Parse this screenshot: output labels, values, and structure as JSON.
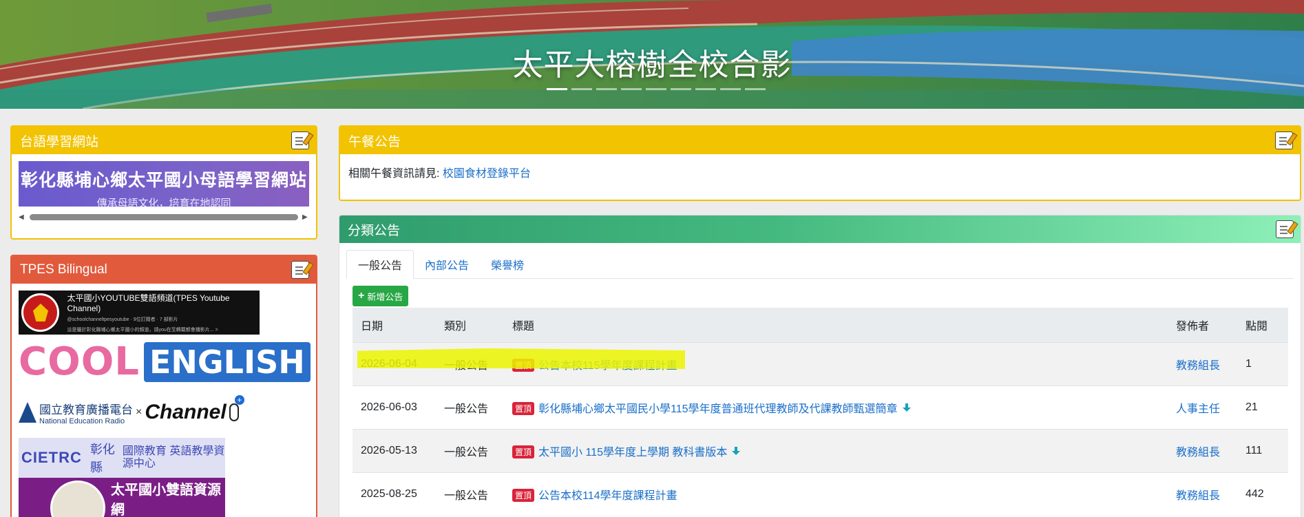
{
  "banner": {
    "title": "太平大榕樹全校合影",
    "slide_count": 9,
    "active_slide": 1
  },
  "taiyu": {
    "header": "台語學習網站",
    "banner_title": "彰化縣埔心鄉太平國小母語學習網站",
    "banner_subtitle": "傳承母語文化，培育在地認同"
  },
  "bilingual": {
    "header": "TPES Bilingual",
    "youtube_title": "太平國小YOUTUBE雙語頻道(TPES Youtube Channel)",
    "youtube_handle": "@schoolchanneltpesyoutube · 9位訂閱者 · 7 部影片",
    "youtube_desc": "這是屬於彰化縣埔心鄉太平國小的頻道，請you在至轉載都會播影片... >",
    "cool": "COOL",
    "english": "ENGLISH",
    "ner_cn": "國立教育廣播電台",
    "ner_en": "National Education Radio",
    "ner_x": "×",
    "channel": "Channel",
    "cietrc_logo": "CIETRC",
    "cietrc_county": "彰化縣",
    "cietrc_name": "國際教育 英語教學資源中心",
    "bilingual_net": "太平國小雙語資源網"
  },
  "lunch": {
    "header": "午餐公告",
    "text": "相關午餐資訊請見: ",
    "link": "校園食材登錄平台"
  },
  "news": {
    "header": "分類公告",
    "tabs": [
      "一般公告",
      "內部公告",
      "榮譽榜"
    ],
    "active_tab": 0,
    "add_button": "新增公告",
    "columns": [
      "日期",
      "類別",
      "標題",
      "發佈者",
      "點閱"
    ],
    "pin_label": "置頂",
    "rows": [
      {
        "date": "2026-06-04",
        "category": "一般公告",
        "title": "公告本校115學年度課程計畫",
        "publisher": "教務組長",
        "views": "1",
        "attachment": false,
        "highlighted": true
      },
      {
        "date": "2026-06-03",
        "category": "一般公告",
        "title": "彰化縣埔心鄉太平國民小學115學年度普通班代理教師及代課教師甄選簡章",
        "publisher": "人事主任",
        "views": "21",
        "attachment": true,
        "highlighted": false
      },
      {
        "date": "2026-05-13",
        "category": "一般公告",
        "title": "太平國小 115學年度上學期 教科書版本",
        "publisher": "教務組長",
        "views": "111",
        "attachment": true,
        "highlighted": false
      },
      {
        "date": "2025-08-25",
        "category": "一般公告",
        "title": "公告本校114學年度課程計畫",
        "publisher": "教務組長",
        "views": "442",
        "attachment": false,
        "highlighted": false
      }
    ]
  }
}
